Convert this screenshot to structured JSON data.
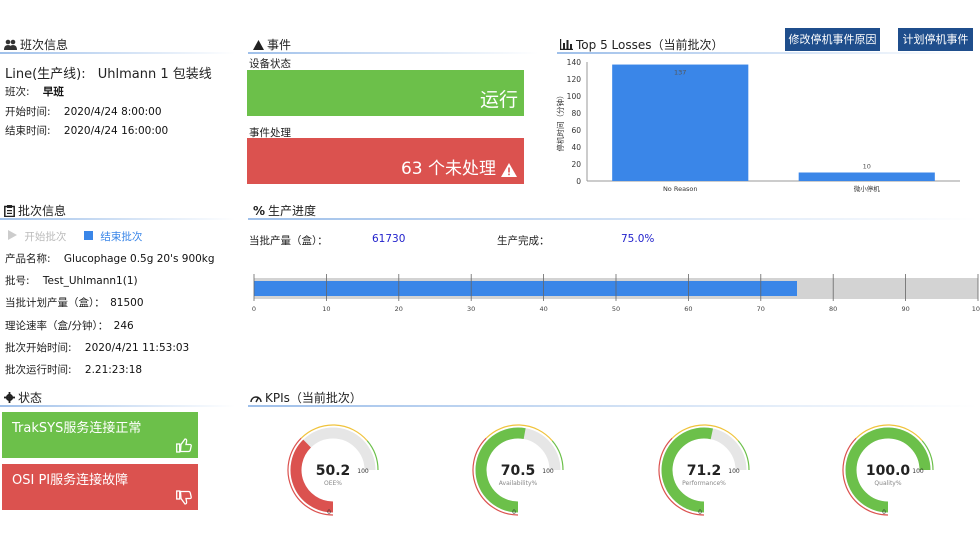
{
  "shift": {
    "title": "班次信息",
    "line_label": "Line(生产线):",
    "line_value": "Uhlmann 1 包装线",
    "shift_label": "班次:",
    "shift_value": "早班",
    "start_label": "开始时间:",
    "start_value": "2020/4/24 8:00:00",
    "end_label": "结束时间:",
    "end_value": "2020/4/24 16:00:00"
  },
  "events": {
    "title": "事件",
    "equipment_label": "设备状态",
    "equipment_status": "运行",
    "handling_label": "事件处理",
    "handling_status": "63 个未处理",
    "colors": {
      "running": "#6cc04a",
      "alarm": "#db524f"
    }
  },
  "losses": {
    "title": "Top 5 Losses（当前批次）",
    "btn_modify": "修改停机事件原因",
    "btn_plan": "计划停机事件",
    "chart_data": {
      "type": "bar",
      "categories": [
        "No Reason",
        "微小停机"
      ],
      "values": [
        137,
        10
      ],
      "ylabel": "停机时间（分钟）",
      "yticks": [
        0,
        20,
        40,
        60,
        80,
        100,
        120,
        140
      ],
      "ylim": [
        0,
        140
      ],
      "bar_color": "#3a86e8",
      "grid": false
    }
  },
  "batch": {
    "title": "批次信息",
    "start_btn": "开始批次",
    "end_btn": "结束批次",
    "product_label": "产品名称:",
    "product_value": "Glucophage 0.5g 20's 900kg",
    "lot_label": "批号:",
    "lot_value": "Test_Uhlmann1(1)",
    "planned_label": "当批计划产量（盒）：",
    "planned_value": "81500",
    "rate_label": "理论速率（盒/分钟）：",
    "rate_value": "246",
    "bstart_label": "批次开始时间:",
    "bstart_value": "2020/4/21 11:53:03",
    "runtime_label": "批次运行时间:",
    "runtime_value": "2.21:23:18"
  },
  "progress": {
    "title": "生产进度",
    "qty_label": "当批产量（盒）：",
    "qty_value": "61730",
    "done_label": "生产完成：",
    "done_value": "75.0%",
    "fraction": 0.75,
    "ticks": [
      "0",
      "10",
      "20",
      "30",
      "40",
      "50",
      "60",
      "70",
      "80",
      "90",
      "100"
    ]
  },
  "status": {
    "title": "状态",
    "traksys": "TrakSYS服务连接正常",
    "osipi": "OSI PI服务连接故障"
  },
  "kpis": {
    "title": "KPIs（当前批次）",
    "min_label": "0",
    "max_label": "100",
    "items": [
      {
        "value": "50.2",
        "name": "OEE%",
        "color": "#db524f",
        "fraction": 0.502
      },
      {
        "value": "70.5",
        "name": "Availability%",
        "color": "#6cc04a",
        "fraction": 0.705
      },
      {
        "value": "71.2",
        "name": "Performance%",
        "color": "#6cc04a",
        "fraction": 0.712
      },
      {
        "value": "100.0",
        "name": "Quality%",
        "color": "#6cc04a",
        "fraction": 1.0
      }
    ]
  }
}
